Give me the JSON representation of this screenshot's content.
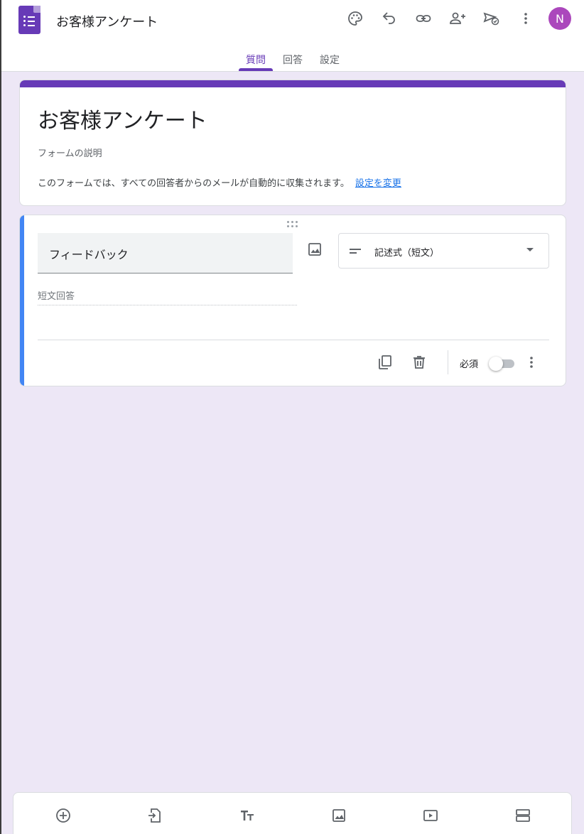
{
  "app": {
    "document_title": "お客様アンケート",
    "avatar_initial": "N",
    "avatar_color": "#ab47bc",
    "accent_color": "#673ab7"
  },
  "toolbar": {
    "icons": [
      "palette-icon",
      "undo-icon",
      "link-icon",
      "add-collaborator-icon",
      "send-icon",
      "more-vert-icon"
    ]
  },
  "tabs": [
    {
      "label": "質問",
      "active": true
    },
    {
      "label": "回答",
      "active": false
    },
    {
      "label": "設定",
      "active": false
    }
  ],
  "form_header": {
    "title": "お客様アンケート",
    "description_placeholder": "フォームの説明",
    "email_notice": "このフォームでは、すべての回答者からのメールが自動的に収集されます。",
    "email_settings_link": "設定を変更"
  },
  "question": {
    "title": "フィードバック",
    "type_label": "記述式（短文）",
    "answer_placeholder": "短文回答",
    "required_label": "必須",
    "required": false,
    "accent_color": "#4285f4"
  },
  "bottom_toolbar": {
    "icons": [
      "add-question-icon",
      "import-question-icon",
      "add-title-icon",
      "add-image-icon",
      "add-video-icon",
      "add-section-icon"
    ]
  }
}
